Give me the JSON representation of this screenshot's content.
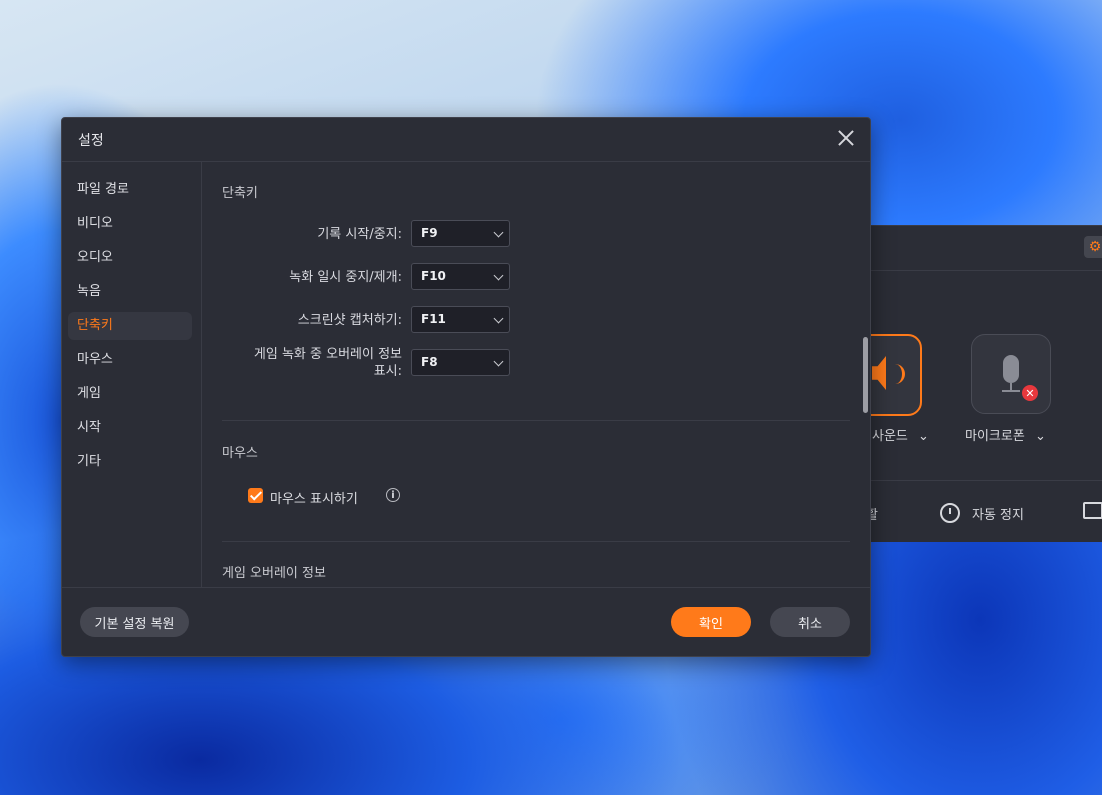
{
  "recorder": {
    "sound_label": "사운드",
    "mic_label": "마이크로폰",
    "partial_label_left": "활",
    "auto_stop_label": "자동 정지"
  },
  "dialog": {
    "title": "설정",
    "sidebar": {
      "items": [
        {
          "label": "파일 경로",
          "active": false
        },
        {
          "label": "비디오",
          "active": false
        },
        {
          "label": "오디오",
          "active": false
        },
        {
          "label": "녹음",
          "active": false
        },
        {
          "label": "단축키",
          "active": true
        },
        {
          "label": "마우스",
          "active": false
        },
        {
          "label": "게임",
          "active": false
        },
        {
          "label": "시작",
          "active": false
        },
        {
          "label": "기타",
          "active": false
        }
      ]
    },
    "shortcuts": {
      "section_title": "단축키",
      "rows": [
        {
          "label": "기록 시작/중지:",
          "value": "F9"
        },
        {
          "label": "녹화 일시 중지/제개:",
          "value": "F10"
        },
        {
          "label": "스크린샷 캡처하기:",
          "value": "F11"
        },
        {
          "label_line1": "게임 녹화 중 오버레이 정보",
          "label_line2": "표시:",
          "value": "F8"
        }
      ]
    },
    "mouse": {
      "section_title": "마우스",
      "show_mouse_label": "마우스 표시하기",
      "show_mouse_checked": true,
      "info_glyph": "i"
    },
    "game_overlay": {
      "section_title": "게임 오버레이 정보"
    },
    "footer": {
      "reset_label": "기본 설정 복원",
      "ok_label": "확인",
      "cancel_label": "취소"
    }
  },
  "colors": {
    "accent": "#ff7a1a",
    "dialog_bg": "#2b2d36",
    "select_bg": "#1f2028"
  }
}
